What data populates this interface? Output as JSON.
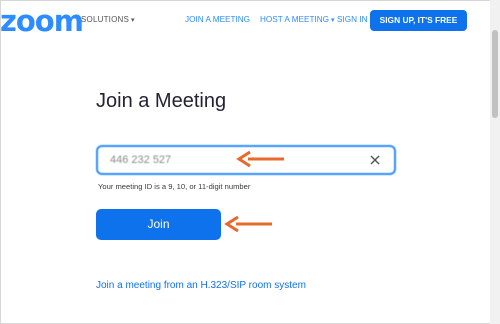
{
  "header": {
    "logo": "zoom",
    "solutions": "SOLUTIONS",
    "join_meeting": "JOIN A MEETING",
    "host_meeting": "HOST A MEETING",
    "sign_in": "SIGN IN",
    "sign_up": "SIGN UP, IT'S FREE"
  },
  "main": {
    "title": "Join a Meeting",
    "meeting_id_value": "446 232 527",
    "hint": "Your meeting ID is a 9, 10, or 11-digit number",
    "join_label": "Join",
    "h323_link": "Join a meeting from an H.323/SIP room system"
  },
  "colors": {
    "brand_blue": "#2d8cff",
    "button_blue": "#0e72ed",
    "annotation_arrow": "#e8692b"
  },
  "icons": [
    "chevron-down-icon",
    "close-icon",
    "arrow-left-icon"
  ]
}
